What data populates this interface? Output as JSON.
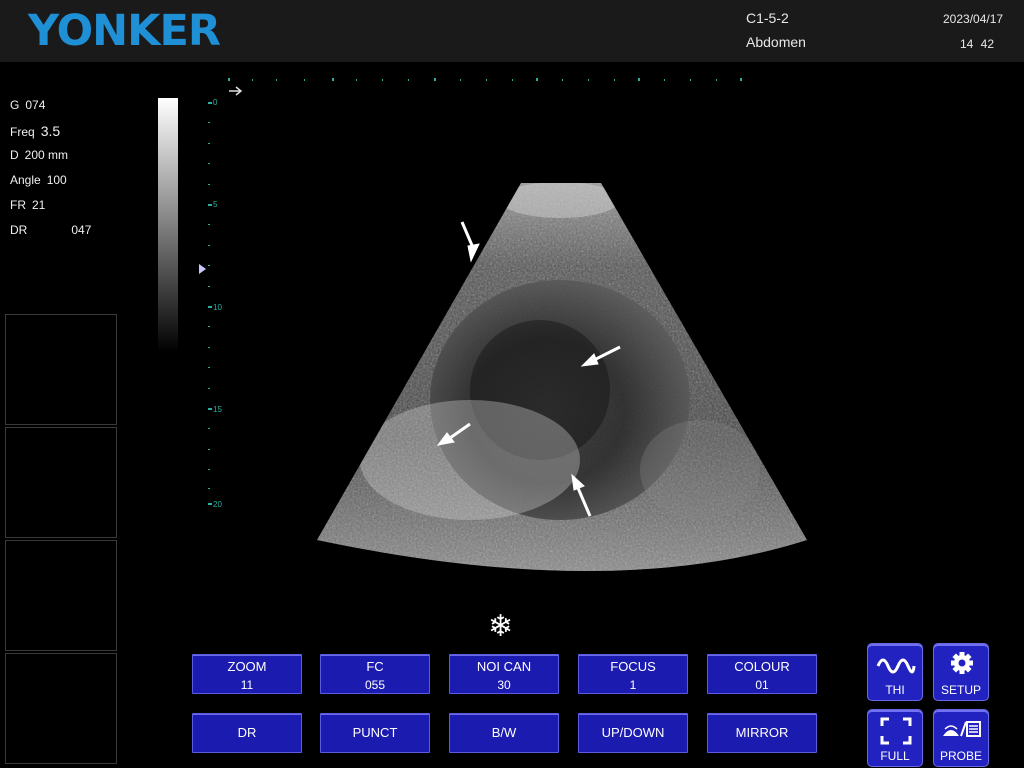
{
  "header": {
    "logo": "YONKER",
    "probe_code": "C1-5-2",
    "exam": "Abdomen",
    "date": "2023/04/17",
    "time": "14 42"
  },
  "params": [
    {
      "label": "G",
      "value": "074"
    },
    {
      "label": "Freq",
      "value": "3.5"
    },
    {
      "label": "D",
      "value": "200 mm"
    },
    {
      "label": "Angle",
      "value": "100"
    },
    {
      "label": "FR",
      "value": "21"
    },
    {
      "label": "DR",
      "value": "047"
    }
  ],
  "depth_scale": {
    "labels": [
      "0",
      "5",
      "10",
      "15",
      "20"
    ]
  },
  "freeze_icon": "snowflake-icon",
  "buttons_row1": [
    {
      "label": "ZOOM",
      "value": "11"
    },
    {
      "label": "FC",
      "value": "055"
    },
    {
      "label": "NOI CAN",
      "value": "30"
    },
    {
      "label": "FOCUS",
      "value": "1"
    },
    {
      "label": "COLOUR",
      "value": "01"
    }
  ],
  "buttons_row2": [
    {
      "label": "DR"
    },
    {
      "label": "PUNCT"
    },
    {
      "label": "B/W"
    },
    {
      "label": "UP/DOWN"
    },
    {
      "label": "MIRROR"
    }
  ],
  "icon_buttons": [
    {
      "label": "THI",
      "icon": "thi-wave-icon"
    },
    {
      "label": "SETUP",
      "icon": "gear-icon"
    },
    {
      "label": "FULL",
      "icon": "fullscreen-icon"
    },
    {
      "label": "PROBE",
      "icon": "probe-icon"
    }
  ],
  "colors": {
    "logo": "#1f8fd6",
    "button": "#1b1bb0",
    "scale_labels": "#2bb0a0"
  }
}
